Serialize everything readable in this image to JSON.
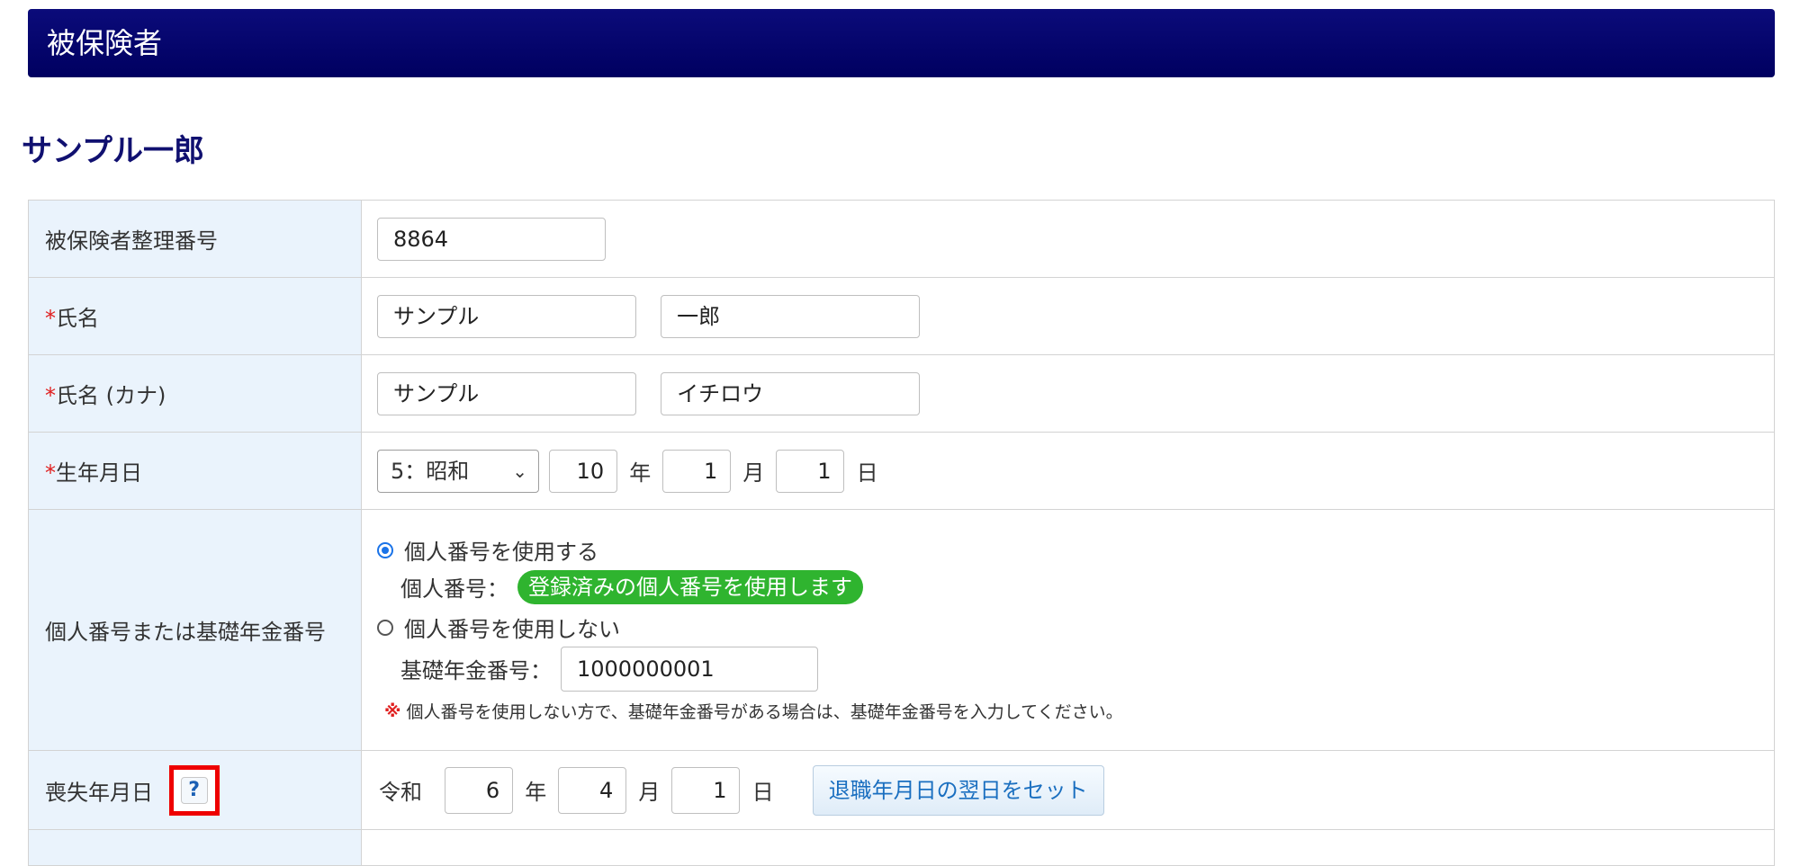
{
  "section": {
    "title": "被保険者"
  },
  "person": {
    "name": "サンプル一郎"
  },
  "rows": {
    "id": {
      "label": "被保険者整理番号",
      "value": "8864"
    },
    "name": {
      "req": "*",
      "label": "氏名",
      "last": "サンプル",
      "first": "一郎"
    },
    "kana": {
      "req": "*",
      "label": "氏名 (カナ)",
      "last": "サンプル",
      "first": "イチロウ"
    },
    "birth": {
      "req": "*",
      "label": "生年月日",
      "era": "5：昭和",
      "year": "10",
      "year_unit": "年",
      "month": "1",
      "month_unit": "月",
      "day": "1",
      "day_unit": "日"
    },
    "mynumber": {
      "label": "個人番号または基礎年金番号",
      "opt_use": "個人番号を使用する",
      "mynumber_label": "個人番号：",
      "badge": "登録済みの個人番号を使用します",
      "opt_nouse": "個人番号を使用しない",
      "pension_label": "基礎年金番号：",
      "pension_value": "1000000001",
      "note_mark": "※",
      "note": "個人番号を使用しない方で、基礎年金番号がある場合は、基礎年金番号を入力してください。"
    },
    "loss": {
      "label": "喪失年月日",
      "help": "?",
      "era": "令和",
      "year": "6",
      "year_unit": "年",
      "month": "4",
      "month_unit": "月",
      "day": "1",
      "day_unit": "日",
      "set_button": "退職年月日の翌日をセット"
    }
  }
}
